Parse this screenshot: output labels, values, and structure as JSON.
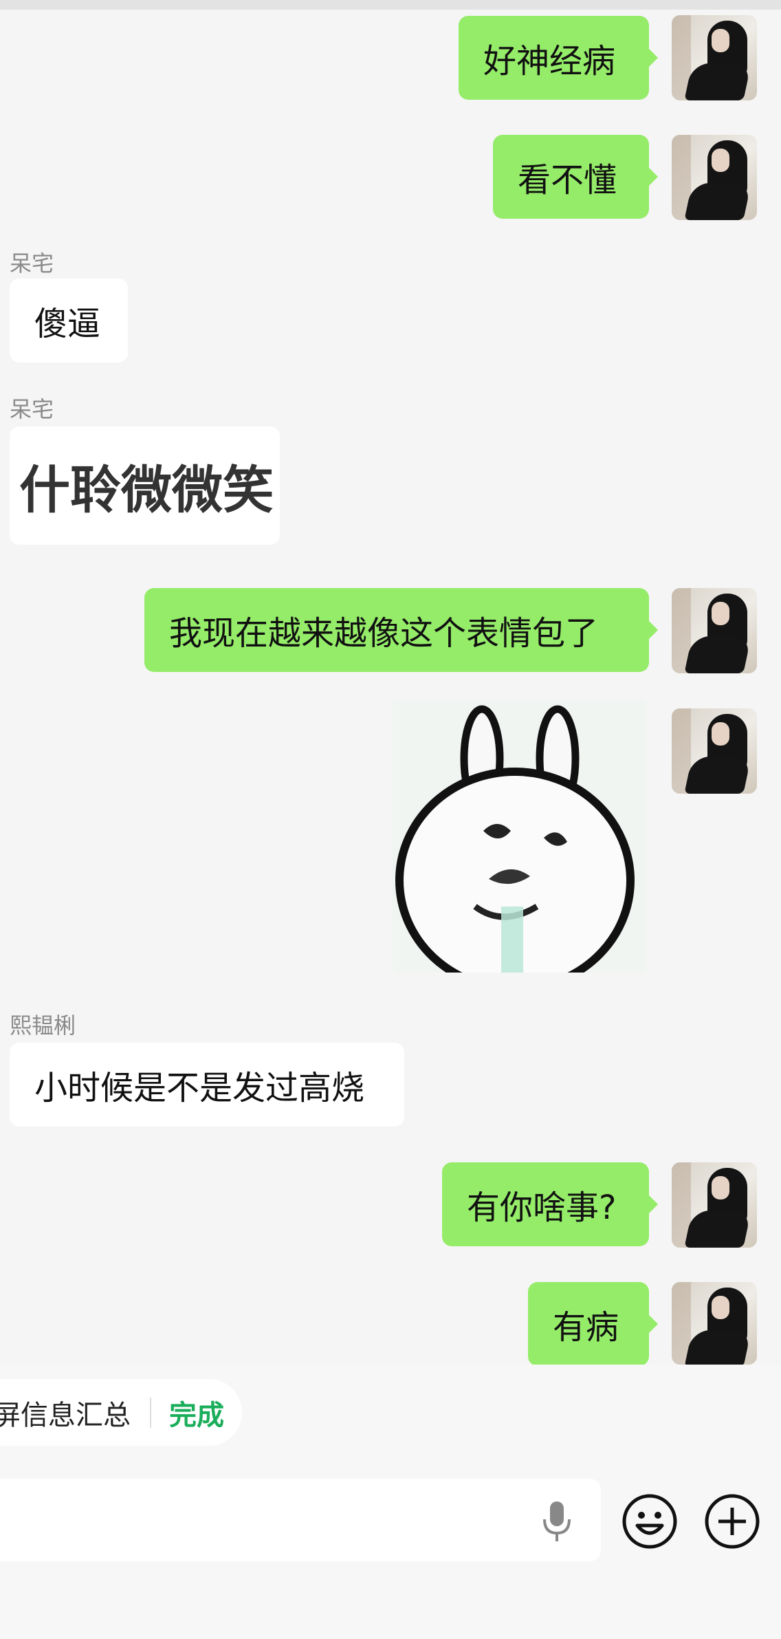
{
  "messages": [
    {
      "side": "sent",
      "text": "好神经病"
    },
    {
      "side": "sent",
      "text": "看不懂"
    },
    {
      "side": "received",
      "sender": "呆宅",
      "text": "傻逼"
    },
    {
      "side": "received",
      "sender": "呆宅",
      "text": "什聆微微笑"
    },
    {
      "side": "sent",
      "text": "我现在越来越像这个表情包了"
    },
    {
      "side": "sent",
      "type": "sticker",
      "sticker": "rabbit-sticker"
    },
    {
      "side": "received",
      "sender": "熙韫梸",
      "text": "小时候是不是发过高烧"
    },
    {
      "side": "sent",
      "text": "有你啥事?"
    },
    {
      "side": "sent",
      "text": "有病"
    }
  ],
  "summary_bar": {
    "text": "屏信息汇总",
    "done_label": "完成"
  },
  "input_bar": {
    "voice_icon": "microphone-icon",
    "emoji_icon": "emoji-icon",
    "more_icon": "plus-circle-icon"
  },
  "colors": {
    "sent_bubble": "#95ec69",
    "received_bubble": "#ffffff",
    "chat_background": "#f5f5f5",
    "accent_green": "#1aad5a"
  }
}
